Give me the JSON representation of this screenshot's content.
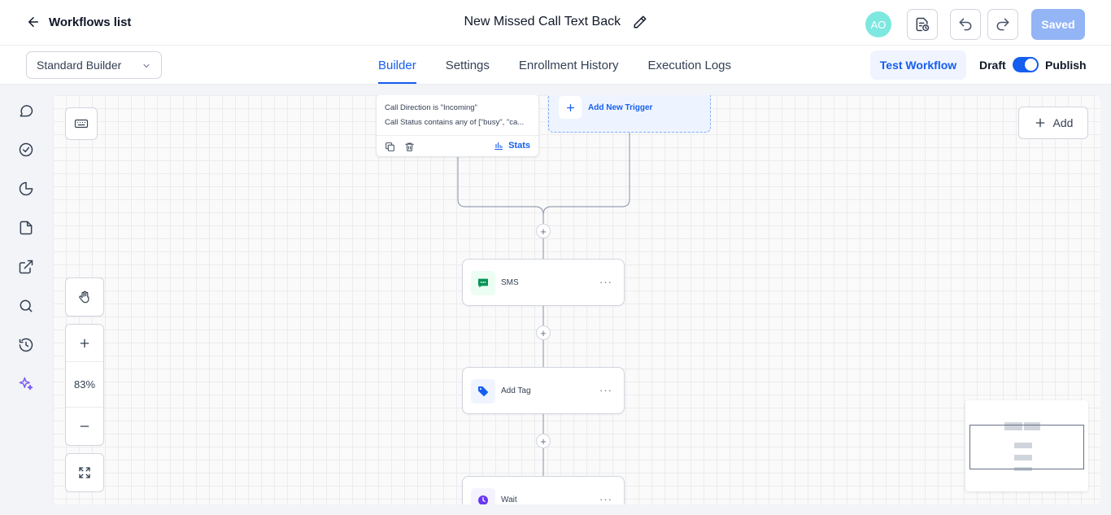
{
  "header": {
    "back_label": "Workflows list",
    "workflow_title": "New Missed Call Text Back",
    "avatar_initials": "AO",
    "saved_label": "Saved"
  },
  "subbar": {
    "builder_select_value": "Standard Builder",
    "tabs": [
      {
        "label": "Builder",
        "active": true
      },
      {
        "label": "Settings",
        "active": false
      },
      {
        "label": "Enrollment History",
        "active": false
      },
      {
        "label": "Execution Logs",
        "active": false
      }
    ],
    "test_workflow_label": "Test Workflow",
    "draft_label": "Draft",
    "publish_label": "Publish"
  },
  "canvas": {
    "zoom_level": "83%",
    "add_label": "Add",
    "trigger": {
      "condition_1": "Call Direction is \"Incoming\"",
      "condition_2": "Call Status contains any of [\"busy\", \"ca...",
      "stats_label": "Stats"
    },
    "add_trigger_label": "Add New Trigger",
    "nodes": [
      {
        "name": "SMS",
        "icon": "sms-icon",
        "color": "#079455"
      },
      {
        "name": "Add Tag",
        "icon": "tag-icon",
        "color": "#155eef"
      },
      {
        "name": "Wait",
        "icon": "clock-icon",
        "color": "#6938ef"
      }
    ]
  },
  "colors": {
    "primary": "#155eef",
    "saved_button": "#93b4f5",
    "avatar": "#7de8e0",
    "sparkle": "#7a5af8"
  }
}
